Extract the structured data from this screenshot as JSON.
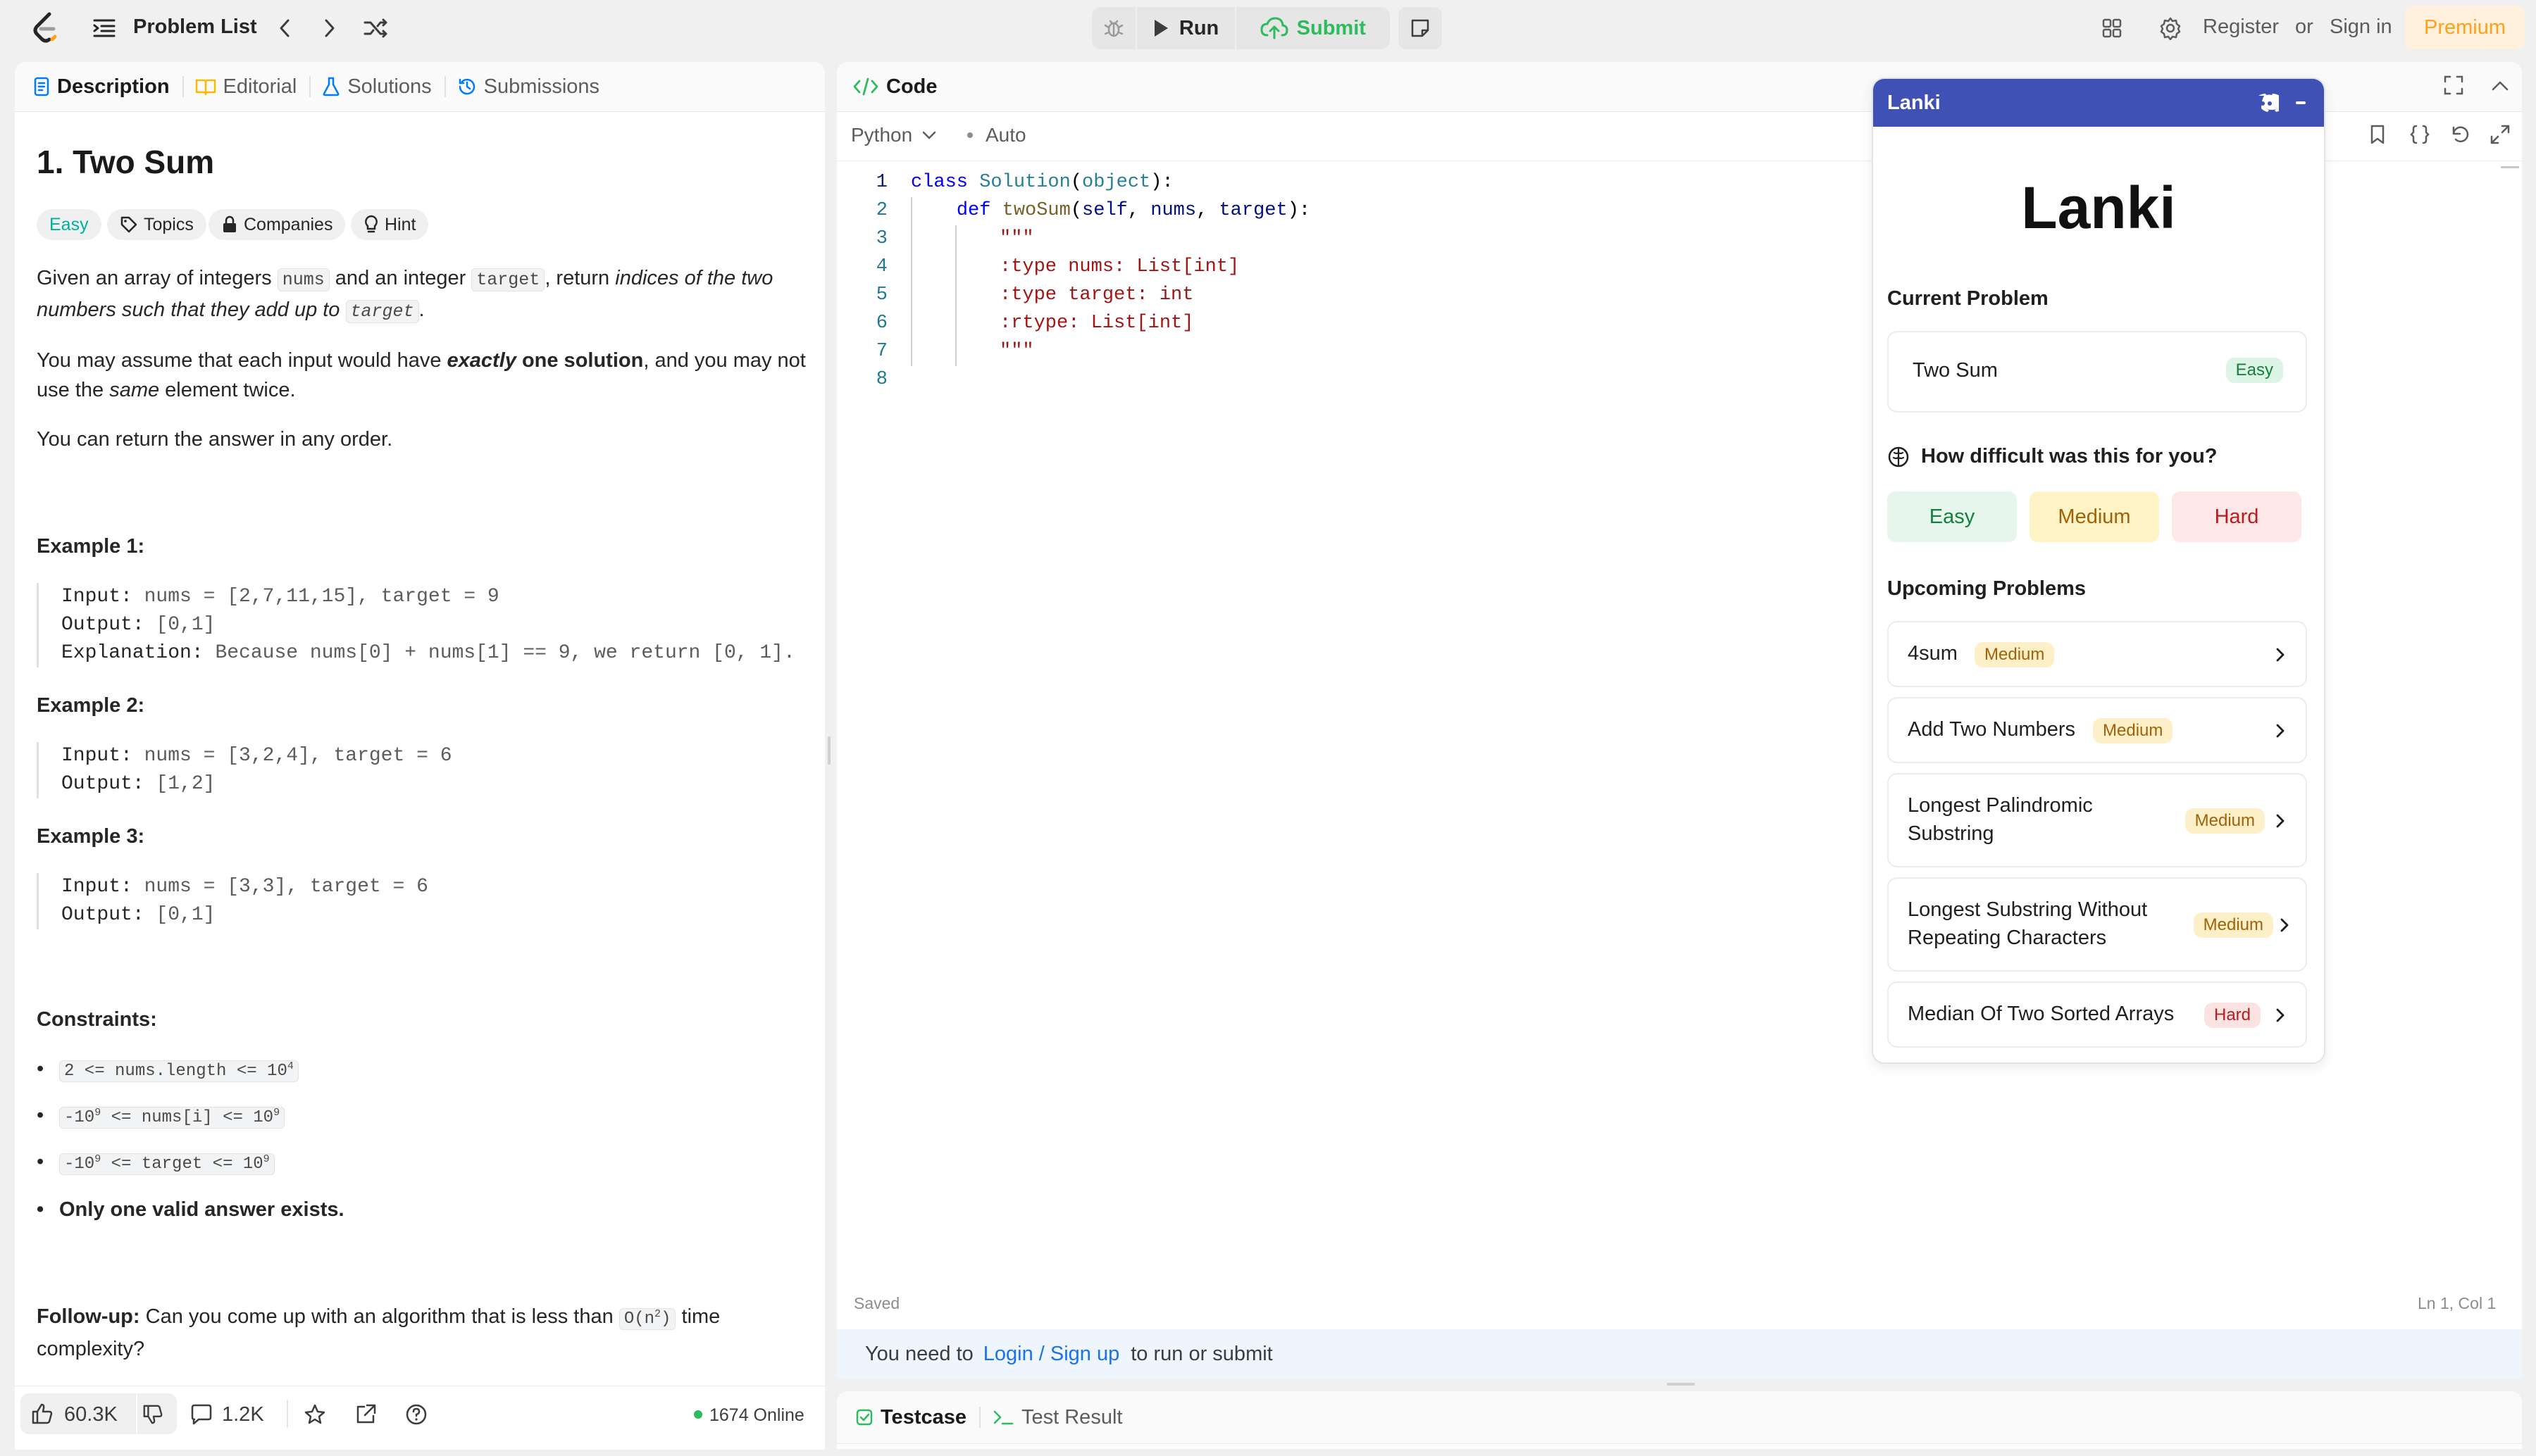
{
  "topbar": {
    "problem_list": "Problem List",
    "run": "Run",
    "submit": "Submit",
    "register": "Register",
    "or": "or",
    "sign_in": "Sign in",
    "premium": "Premium",
    "colors": {
      "accent_orange": "#ffa116",
      "submit_green": "#2cbb5d"
    }
  },
  "desc_tabs": [
    "Description",
    "Editorial",
    "Solutions",
    "Submissions"
  ],
  "problem": {
    "title": "1. Two Sum",
    "difficulty": "Easy",
    "tags": [
      "Topics",
      "Companies",
      "Hint"
    ],
    "p1": {
      "a": "Given an array of integers ",
      "code1": "nums",
      "b": " and an integer ",
      "code2": "target",
      "c": ", return ",
      "em": "indices of the two numbers such that they add up to",
      "d": " ",
      "code3": "target",
      "e": "."
    },
    "p2": {
      "a": "You may assume that each input would have ",
      "strong_em": "exactly",
      "strong": " one solution",
      "b": ", and you may not use the ",
      "em": "same",
      "c": " element twice."
    },
    "p3": "You can return the answer in any order.",
    "examples": [
      {
        "title": "Example 1:",
        "input_label": "Input:",
        "input": " nums = [2,7,11,15], target = 9",
        "output_label": "Output:",
        "output": " [0,1]",
        "explanation_label": "Explanation:",
        "explanation": " Because nums[0] + nums[1] == 9, we return [0, 1]."
      },
      {
        "title": "Example 2:",
        "input_label": "Input:",
        "input": " nums = [3,2,4], target = 6",
        "output_label": "Output:",
        "output": " [1,2]"
      },
      {
        "title": "Example 3:",
        "input_label": "Input:",
        "input": " nums = [3,3], target = 6",
        "output_label": "Output:",
        "output": " [0,1]"
      }
    ],
    "constraints_title": "Constraints:",
    "constraints": [
      {
        "pre": "2 <= nums.length <= 10",
        "sup": "4",
        "post": ""
      },
      {
        "pre": "-10",
        "sup": "9",
        "mid": " <= nums[i] <= 10",
        "sup2": "9"
      },
      {
        "pre": "-10",
        "sup": "9",
        "mid": " <= target <= 10",
        "sup2": "9"
      }
    ],
    "constraint_bold": "Only one valid answer exists.",
    "followup_label": "Follow-up:",
    "followup_a": " Can you come up with an algorithm that is less than ",
    "followup_code": "O(n",
    "followup_sup": "2",
    "followup_code_end": ")",
    "followup_b": " time complexity?"
  },
  "desc_footer": {
    "likes": "60.3K",
    "comments": "1.2K",
    "online": "1674 Online"
  },
  "code_panel": {
    "title": "Code",
    "language": "Python",
    "auto": "Auto",
    "saved": "Saved",
    "cursor": "Ln 1, Col 1",
    "login_prefix": "You need to",
    "login_link": "Login / Sign up",
    "login_suffix": "to run or submit",
    "lines": [
      "1",
      "2",
      "3",
      "4",
      "5",
      "6",
      "7",
      "8"
    ],
    "code": {
      "l1_kw": "class",
      "l1_cls": "Solution",
      "l1_p1": "(",
      "l1_base": "object",
      "l1_p2": "):",
      "l2_kw": "def",
      "l2_fn": "twoSum",
      "l2_p1": "(",
      "l2_a1": "self",
      "l2_c1": ", ",
      "l2_a2": "nums",
      "l2_c2": ", ",
      "l2_a3": "target",
      "l2_p2": "):",
      "l3": "\"\"\"",
      "l4": ":type nums: List[int]",
      "l5": ":type target: int",
      "l6": ":rtype: List[int]",
      "l7": "\"\"\""
    }
  },
  "bottom_tabs": [
    "Testcase",
    "Test Result"
  ],
  "lanki": {
    "header": "Lanki",
    "brand": "Lanki",
    "current_label": "Current Problem",
    "current_title": "Two Sum",
    "current_difficulty": "Easy",
    "question": "How difficult was this for you?",
    "ratings": [
      "Easy",
      "Medium",
      "Hard"
    ],
    "upcoming_label": "Upcoming Problems",
    "upcoming": [
      {
        "title": "4sum",
        "difficulty": "Medium"
      },
      {
        "title": "Add Two Numbers",
        "difficulty": "Medium"
      },
      {
        "title_line1": "Longest Palindromic",
        "title_line2": "Substring",
        "difficulty": "Medium"
      },
      {
        "title_line1": "Longest Substring Without",
        "title_line2": "Repeating Characters",
        "difficulty": "Medium"
      },
      {
        "title": "Median Of Two Sorted Arrays",
        "difficulty": "Hard"
      }
    ],
    "colors": {
      "header_bg": "#3f51b5"
    }
  }
}
